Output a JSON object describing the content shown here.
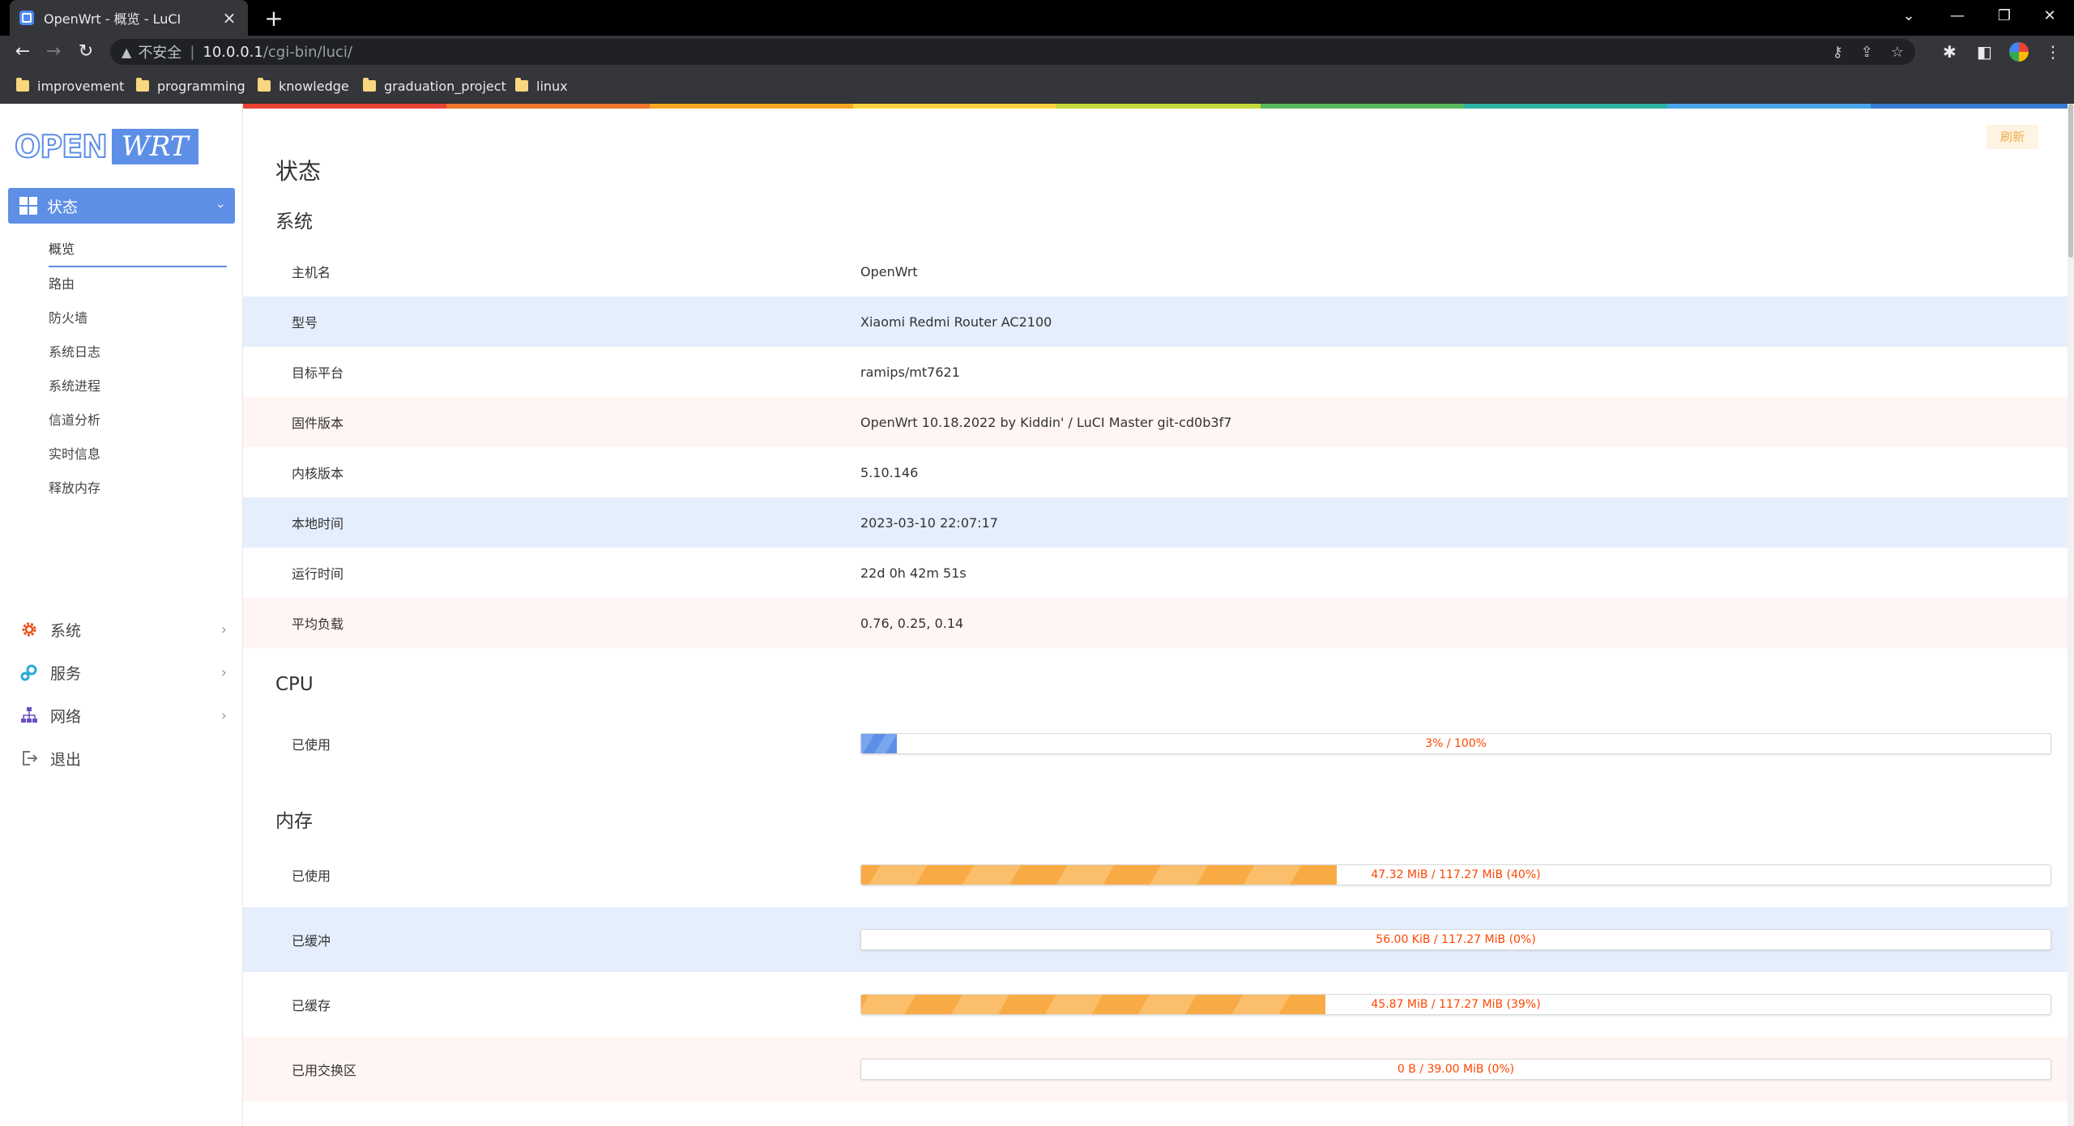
{
  "browser": {
    "tab_title": "OpenWrt - 概览 - LuCI",
    "insecure_label": "不安全",
    "url_host": "10.0.0.1",
    "url_path": "/cgi-bin/luci/",
    "bookmarks": [
      "improvement",
      "programming",
      "knowledge",
      "graduation_project",
      "linux"
    ]
  },
  "sidebar": {
    "logo_left": "OPEN",
    "logo_right": "WRT",
    "active_menu": "状态",
    "submenu": [
      "概览",
      "路由",
      "防火墙",
      "系统日志",
      "系统进程",
      "信道分析",
      "实时信息",
      "释放内存"
    ],
    "menu": [
      "系统",
      "服务",
      "网络",
      "退出"
    ]
  },
  "main": {
    "refresh_label": "刷新",
    "page_title": "状态",
    "system_heading": "系统",
    "system_rows": [
      {
        "key": "主机名",
        "value": "OpenWrt"
      },
      {
        "key": "型号",
        "value": "Xiaomi Redmi Router AC2100"
      },
      {
        "key": "目标平台",
        "value": "ramips/mt7621"
      },
      {
        "key": "固件版本",
        "value": "OpenWrt 10.18.2022 by Kiddin' / LuCI Master git-cd0b3f7"
      },
      {
        "key": "内核版本",
        "value": "5.10.146"
      },
      {
        "key": "本地时间",
        "value": "2023-03-10 22:07:17"
      },
      {
        "key": "运行时间",
        "value": "22d 0h 42m 51s"
      },
      {
        "key": "平均负载",
        "value": "0.76, 0.25, 0.14"
      }
    ],
    "cpu_heading": "CPU",
    "cpu_rows": [
      {
        "key": "已使用",
        "text": "3% / 100%",
        "fraction": 0.03
      }
    ],
    "memory_heading": "内存",
    "memory_rows": [
      {
        "key": "已使用",
        "text": "47.32 MiB / 117.27 MiB (40%)",
        "fraction": 0.4
      },
      {
        "key": "已缓冲",
        "text": "56.00 KiB / 117.27 MiB (0%)",
        "fraction": 0.0
      },
      {
        "key": "已缓存",
        "text": "45.87 MiB / 117.27 MiB (39%)",
        "fraction": 0.39
      },
      {
        "key": "已用交换区",
        "text": "0 B / 39.00 MiB (0%)",
        "fraction": 0.0
      }
    ]
  },
  "colors": {
    "accent": "#5d8fe6",
    "rainbow": [
      "#ea4335",
      "#f0752d",
      "#f5a623",
      "#fbd23c",
      "#c3d939",
      "#5cb85c",
      "#2bb3a6",
      "#4aa6e8",
      "#3a7bd5"
    ]
  }
}
